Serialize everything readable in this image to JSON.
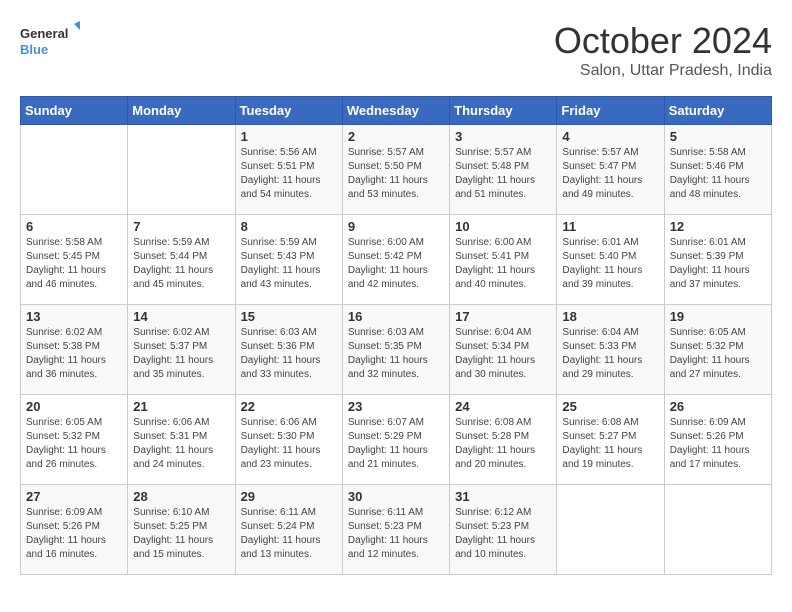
{
  "header": {
    "logo_general": "General",
    "logo_blue": "Blue",
    "month_title": "October 2024",
    "location": "Salon, Uttar Pradesh, India"
  },
  "columns": [
    "Sunday",
    "Monday",
    "Tuesday",
    "Wednesday",
    "Thursday",
    "Friday",
    "Saturday"
  ],
  "weeks": [
    [
      {
        "day": "",
        "info": ""
      },
      {
        "day": "",
        "info": ""
      },
      {
        "day": "1",
        "info": "Sunrise: 5:56 AM\nSunset: 5:51 PM\nDaylight: 11 hours and 54 minutes."
      },
      {
        "day": "2",
        "info": "Sunrise: 5:57 AM\nSunset: 5:50 PM\nDaylight: 11 hours and 53 minutes."
      },
      {
        "day": "3",
        "info": "Sunrise: 5:57 AM\nSunset: 5:48 PM\nDaylight: 11 hours and 51 minutes."
      },
      {
        "day": "4",
        "info": "Sunrise: 5:57 AM\nSunset: 5:47 PM\nDaylight: 11 hours and 49 minutes."
      },
      {
        "day": "5",
        "info": "Sunrise: 5:58 AM\nSunset: 5:46 PM\nDaylight: 11 hours and 48 minutes."
      }
    ],
    [
      {
        "day": "6",
        "info": "Sunrise: 5:58 AM\nSunset: 5:45 PM\nDaylight: 11 hours and 46 minutes."
      },
      {
        "day": "7",
        "info": "Sunrise: 5:59 AM\nSunset: 5:44 PM\nDaylight: 11 hours and 45 minutes."
      },
      {
        "day": "8",
        "info": "Sunrise: 5:59 AM\nSunset: 5:43 PM\nDaylight: 11 hours and 43 minutes."
      },
      {
        "day": "9",
        "info": "Sunrise: 6:00 AM\nSunset: 5:42 PM\nDaylight: 11 hours and 42 minutes."
      },
      {
        "day": "10",
        "info": "Sunrise: 6:00 AM\nSunset: 5:41 PM\nDaylight: 11 hours and 40 minutes."
      },
      {
        "day": "11",
        "info": "Sunrise: 6:01 AM\nSunset: 5:40 PM\nDaylight: 11 hours and 39 minutes."
      },
      {
        "day": "12",
        "info": "Sunrise: 6:01 AM\nSunset: 5:39 PM\nDaylight: 11 hours and 37 minutes."
      }
    ],
    [
      {
        "day": "13",
        "info": "Sunrise: 6:02 AM\nSunset: 5:38 PM\nDaylight: 11 hours and 36 minutes."
      },
      {
        "day": "14",
        "info": "Sunrise: 6:02 AM\nSunset: 5:37 PM\nDaylight: 11 hours and 35 minutes."
      },
      {
        "day": "15",
        "info": "Sunrise: 6:03 AM\nSunset: 5:36 PM\nDaylight: 11 hours and 33 minutes."
      },
      {
        "day": "16",
        "info": "Sunrise: 6:03 AM\nSunset: 5:35 PM\nDaylight: 11 hours and 32 minutes."
      },
      {
        "day": "17",
        "info": "Sunrise: 6:04 AM\nSunset: 5:34 PM\nDaylight: 11 hours and 30 minutes."
      },
      {
        "day": "18",
        "info": "Sunrise: 6:04 AM\nSunset: 5:33 PM\nDaylight: 11 hours and 29 minutes."
      },
      {
        "day": "19",
        "info": "Sunrise: 6:05 AM\nSunset: 5:32 PM\nDaylight: 11 hours and 27 minutes."
      }
    ],
    [
      {
        "day": "20",
        "info": "Sunrise: 6:05 AM\nSunset: 5:32 PM\nDaylight: 11 hours and 26 minutes."
      },
      {
        "day": "21",
        "info": "Sunrise: 6:06 AM\nSunset: 5:31 PM\nDaylight: 11 hours and 24 minutes."
      },
      {
        "day": "22",
        "info": "Sunrise: 6:06 AM\nSunset: 5:30 PM\nDaylight: 11 hours and 23 minutes."
      },
      {
        "day": "23",
        "info": "Sunrise: 6:07 AM\nSunset: 5:29 PM\nDaylight: 11 hours and 21 minutes."
      },
      {
        "day": "24",
        "info": "Sunrise: 6:08 AM\nSunset: 5:28 PM\nDaylight: 11 hours and 20 minutes."
      },
      {
        "day": "25",
        "info": "Sunrise: 6:08 AM\nSunset: 5:27 PM\nDaylight: 11 hours and 19 minutes."
      },
      {
        "day": "26",
        "info": "Sunrise: 6:09 AM\nSunset: 5:26 PM\nDaylight: 11 hours and 17 minutes."
      }
    ],
    [
      {
        "day": "27",
        "info": "Sunrise: 6:09 AM\nSunset: 5:26 PM\nDaylight: 11 hours and 16 minutes."
      },
      {
        "day": "28",
        "info": "Sunrise: 6:10 AM\nSunset: 5:25 PM\nDaylight: 11 hours and 15 minutes."
      },
      {
        "day": "29",
        "info": "Sunrise: 6:11 AM\nSunset: 5:24 PM\nDaylight: 11 hours and 13 minutes."
      },
      {
        "day": "30",
        "info": "Sunrise: 6:11 AM\nSunset: 5:23 PM\nDaylight: 11 hours and 12 minutes."
      },
      {
        "day": "31",
        "info": "Sunrise: 6:12 AM\nSunset: 5:23 PM\nDaylight: 11 hours and 10 minutes."
      },
      {
        "day": "",
        "info": ""
      },
      {
        "day": "",
        "info": ""
      }
    ]
  ]
}
